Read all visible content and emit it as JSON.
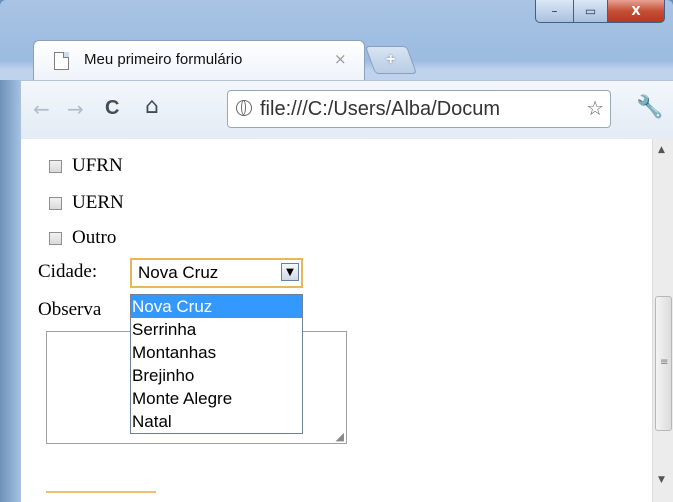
{
  "window": {
    "min": "–",
    "max": "▭",
    "close": "X"
  },
  "tab": {
    "title": "Meu primeiro formulário",
    "close": "×"
  },
  "newtab": "+",
  "toolbar": {
    "back": "←",
    "forward": "→",
    "reload": "C",
    "home": "⌂",
    "url": "file:///C:/Users/Alba/Docum",
    "star": "☆",
    "wrench": "🔧"
  },
  "form": {
    "checkboxes": [
      {
        "label": "UFRN"
      },
      {
        "label": "UERN"
      },
      {
        "label": "Outro"
      }
    ],
    "cidade_label": "Cidade:",
    "cidade_value": "Nova Cruz",
    "obs_label": "Observa",
    "options": [
      "Nova Cruz",
      "Serrinha",
      "Montanhas",
      "Brejinho",
      "Monte Alegre",
      "Natal"
    ],
    "selected_index": 0
  },
  "scrollbar": {
    "up": "▲",
    "down": "▼",
    "grip": "≡"
  }
}
